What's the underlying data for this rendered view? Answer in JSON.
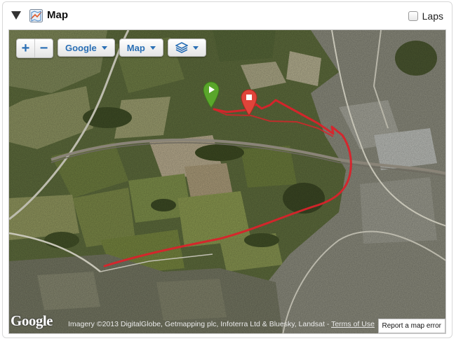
{
  "header": {
    "title": "Map",
    "laps_label": "Laps",
    "laps_checked": false
  },
  "map": {
    "controls": {
      "zoom_in": "+",
      "zoom_out": "−",
      "provider": "Google",
      "type": "Map",
      "layers_icon": "layers-icon"
    },
    "logo": "Google",
    "attribution": "Imagery ©2013 DigitalGlobe, Getmapping plc, Infoterra Ltd & Bluesky, Landsat -",
    "terms_label": "Terms of Use",
    "report_label": "Report a map error",
    "markers": [
      "start-marker",
      "end-marker"
    ],
    "route_color": "#d9232b"
  }
}
